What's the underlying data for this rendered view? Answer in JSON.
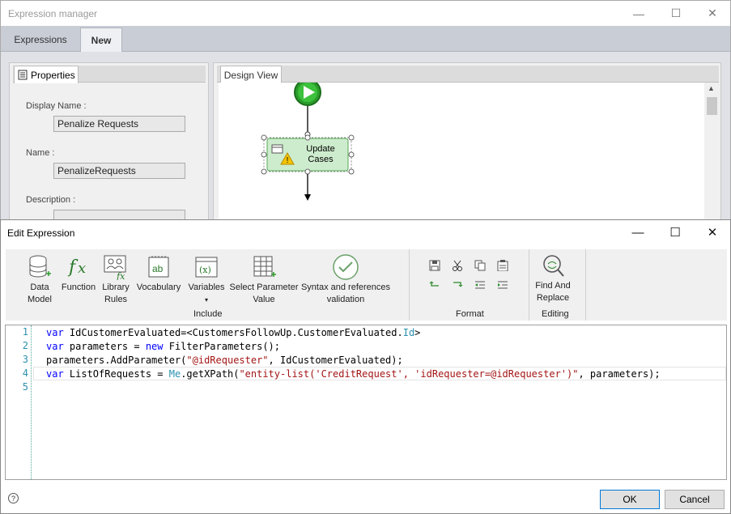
{
  "background_window": {
    "title": "Expression manager",
    "tabs": [
      "Expressions",
      "New"
    ],
    "active_tab": "New",
    "properties_panel": {
      "tab_label": "Properties",
      "display_name_label": "Display Name :",
      "display_name_value": "Penalize Requests",
      "name_label": "Name :",
      "name_value": "PenalizeRequests",
      "description_label": "Description :"
    },
    "design_view": {
      "tab_label": "Design View",
      "task_label_line1": "Update",
      "task_label_line2": "Cases"
    }
  },
  "dialog": {
    "title": "Edit Expression",
    "ribbon": {
      "include_buttons": [
        {
          "line1": "Data",
          "line2": "Model"
        },
        {
          "line1": "Function",
          "line2": ""
        },
        {
          "line1": "Library",
          "line2": "Rules"
        },
        {
          "line1": "Vocabulary",
          "line2": ""
        },
        {
          "line1": "Variables",
          "line2": "▾"
        },
        {
          "line1": "Select Parameter",
          "line2": "Value"
        },
        {
          "line1": "Syntax and references",
          "line2": "validation"
        }
      ],
      "include_label": "Include",
      "format_label": "Format",
      "find_replace_line1": "Find And",
      "find_replace_line2": "Replace",
      "editing_label": "Editing"
    },
    "editor": {
      "line_numbers": [
        "1",
        "2",
        "3",
        "4",
        "5"
      ],
      "lines": [
        [
          {
            "t": "var ",
            "c": "kw"
          },
          {
            "t": "IdCustomerEvaluated=<CustomersFollowUp.CustomerEvaluated.",
            "c": "pl"
          },
          {
            "t": "Id",
            "c": "ty"
          },
          {
            "t": ">",
            "c": "pl"
          }
        ],
        [
          {
            "t": "var ",
            "c": "kw"
          },
          {
            "t": "parameters = ",
            "c": "pl"
          },
          {
            "t": "new ",
            "c": "kw"
          },
          {
            "t": "FilterParameters();",
            "c": "pl"
          }
        ],
        [
          {
            "t": "parameters.AddParameter(",
            "c": "pl"
          },
          {
            "t": "\"@idRequester\"",
            "c": "st"
          },
          {
            "t": ", IdCustomerEvaluated);",
            "c": "pl"
          }
        ],
        [
          {
            "t": "var ",
            "c": "kw"
          },
          {
            "t": "ListOfRequests = ",
            "c": "pl"
          },
          {
            "t": "Me",
            "c": "ty"
          },
          {
            "t": ".getXPath(",
            "c": "pl"
          },
          {
            "t": "\"entity-list('CreditRequest', 'idRequester=@idRequester')\"",
            "c": "st"
          },
          {
            "t": ", parameters);",
            "c": "pl"
          }
        ],
        []
      ]
    },
    "footer": {
      "help": "?",
      "ok_label": "OK",
      "cancel_label": "Cancel"
    }
  },
  "colors": {
    "keyword": "#0000ff",
    "type": "#2b91af",
    "string": "#a31515",
    "accent": "#0078d7"
  }
}
